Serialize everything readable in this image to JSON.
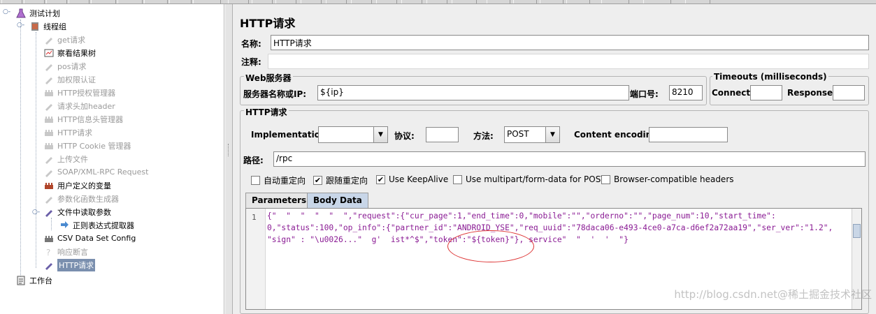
{
  "tree": {
    "items": [
      {
        "label": "测试计划",
        "disabled": false
      },
      {
        "label": "线程组",
        "disabled": false
      },
      {
        "label": "get请求",
        "disabled": true
      },
      {
        "label": "察看结果树",
        "disabled": false
      },
      {
        "label": "pos请求",
        "disabled": true
      },
      {
        "label": "加权限认证",
        "disabled": true
      },
      {
        "label": "HTTP授权管理器",
        "disabled": true
      },
      {
        "label": "请求头加header",
        "disabled": true
      },
      {
        "label": "HTTP信息头管理器",
        "disabled": true
      },
      {
        "label": "HTTP请求",
        "disabled": true
      },
      {
        "label": "HTTP Cookie 管理器",
        "disabled": true
      },
      {
        "label": "上传文件",
        "disabled": true
      },
      {
        "label": "SOAP/XML-RPC Request",
        "disabled": true
      },
      {
        "label": "用户定义的变量",
        "disabled": false
      },
      {
        "label": "参数化函数生成器",
        "disabled": true
      },
      {
        "label": "文件中读取参数",
        "disabled": false
      },
      {
        "label": "正则表达式提取器",
        "disabled": false
      },
      {
        "label": "CSV Data Set Config",
        "disabled": false
      },
      {
        "label": "响应断言",
        "disabled": true
      },
      {
        "label": "HTTP请求",
        "disabled": false,
        "selected": true
      },
      {
        "label": "工作台",
        "disabled": false
      }
    ]
  },
  "panel": {
    "title": "HTTP请求",
    "name_label": "名称:",
    "name_value": "HTTP请求",
    "comment_label": "注释:",
    "comment_value": "",
    "web_server": {
      "group_title": "Web服务器",
      "server_label": "服务器名称或IP:",
      "server_value": "${ip}",
      "port_label": "端口号:",
      "port_value": "8210"
    },
    "timeouts": {
      "group_title": "Timeouts (milliseconds)",
      "connect_label": "Connect:",
      "connect_value": "",
      "response_label": "Response:",
      "response_value": ""
    },
    "http_request": {
      "group_title": "HTTP请求",
      "implementation_label": "Implementation:",
      "implementation_value": "",
      "protocol_label": "协议:",
      "protocol_value": "",
      "method_label": "方法:",
      "method_value": "POST",
      "encoding_label": "Content encoding:",
      "encoding_value": "",
      "path_label": "路径:",
      "path_value": "/rpc"
    },
    "checkboxes": [
      {
        "label": "自动重定向",
        "checked": false
      },
      {
        "label": "跟随重定向",
        "checked": true
      },
      {
        "label": "Use KeepAlive",
        "checked": true
      },
      {
        "label": "Use multipart/form-data for POST",
        "checked": false
      },
      {
        "label": "Browser-compatible headers",
        "checked": false
      }
    ],
    "tabs": [
      {
        "label": "Parameters",
        "active": false
      },
      {
        "label": "Body Data",
        "active": true
      }
    ],
    "body": {
      "line_number": "1",
      "line1": "{\"  \"  \"  \"  \"  \",\"request\":{\"cur_page\":1,\"end_time\":0,\"mobile\":\"\",\"orderno\":\"\",\"page_num\":10,\"start_time\":",
      "line2": "0,\"status\":100,\"op_info\":{\"partner_id\":\"ANDROID_YSE\",\"req_uuid\":\"78daca06-e493-4ce0-a7ca-d6ef2a72aa19\",\"ser_ver\":\"1.2\",",
      "line3": "\"sign\" : \"\\u0026...\"  g'  ist*^$\",\"token\":\"${token}\"}, service\"  \"  '  '  \"}"
    },
    "watermark": "http://blog.csdn.net@稀土掘金技术社区"
  }
}
